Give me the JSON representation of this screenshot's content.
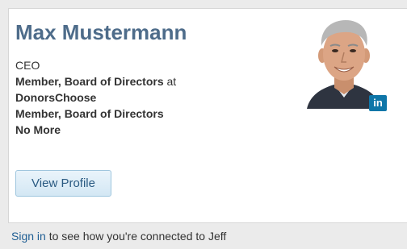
{
  "profile": {
    "name": "Max Mustermann",
    "headline": "CEO",
    "positions": [
      {
        "title": "Member, Board of Directors",
        "connector": " at",
        "company": "DonorsChoose"
      },
      {
        "title": "Member, Board of Directors",
        "company": "No More"
      }
    ],
    "view_profile_label": "View Profile",
    "linkedin_badge_text": "in",
    "photo_icon": "profile-photo"
  },
  "footer": {
    "sign_in_label": "Sign in",
    "connection_text": " to see how you're connected to Jeff"
  },
  "colors": {
    "name": "#4e6c8a",
    "link": "#1f5e93",
    "button_text": "#2a5a82",
    "linkedin": "#0e76a8"
  }
}
